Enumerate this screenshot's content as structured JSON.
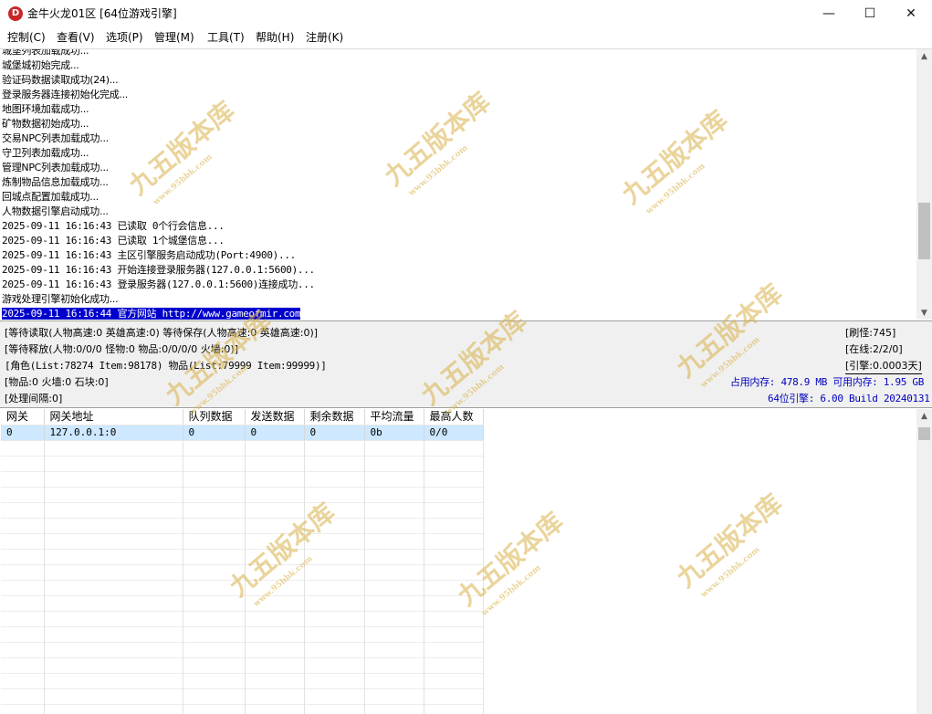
{
  "window": {
    "app_icon_letter": "D",
    "title": "金牛火龙01区 [64位游戏引擎]",
    "minimize_glyph": "—",
    "maximize_glyph": "☐",
    "close_glyph": "✕"
  },
  "menu": [
    "控制(C)",
    "查看(V)",
    "选项(P)",
    "管理(M)",
    "工具(T)",
    "帮助(H)",
    "注册(K)"
  ],
  "log": [
    "城堡列表加载成功...",
    "城堡城初始完成...",
    "验证码数据读取成功(24)...",
    "登录服务器连接初始化完成...",
    "地图环境加载成功...",
    "矿物数据初始成功...",
    "交易NPC列表加载成功...",
    "守卫列表加载成功...",
    "管理NPC列表加载成功...",
    "炼制物品信息加载成功...",
    "回城点配置加载成功...",
    "人物数据引擎启动成功...",
    "2025-09-11 16:16:43 已读取 0个行会信息...",
    "2025-09-11 16:16:43 已读取 1个城堡信息...",
    "2025-09-11 16:16:43 主区引擎服务启动成功(Port:4900)...",
    "2025-09-11 16:16:43 开始连接登录服务器(127.0.0.1:5600)...",
    "2025-09-11 16:16:43 登录服务器(127.0.0.1:5600)连接成功...",
    "游戏处理引擎初始化成功...",
    "2025-09-11 16:16:44 官方网站 http://www.gameofmir.com"
  ],
  "status": {
    "wait_read": "[等待读取(人物高速:0 英雄高速:0) 等待保存(人物高速:0 英雄高速:0)]",
    "wait_release": "[等待释放(人物:0/0/0 怪物:0 物品:0/0/0/0 火墙:0)]",
    "role_list": "[角色(List:78274 Item:98178) 物品(List:79999 Item:99999)]",
    "items": "[物品:0 火墙:0 石块:0]",
    "interval": "[处理间隔:0]",
    "refresh_monster": "[刷怪:745]",
    "online": "[在线:2/2/0]",
    "engine": "[引擎:0.0003天]",
    "memory": "占用内存: 478.9 MB 可用内存: 1.95 GB",
    "build": "64位引擎: 6.00 Build 20240131"
  },
  "gateway_table": {
    "columns": [
      "网关",
      "网关地址",
      "队列数据",
      "发送数据",
      "剩余数据",
      "平均流量",
      "最高人数"
    ],
    "rows": [
      [
        "0",
        "127.0.0.1:0",
        "0",
        "0",
        "0",
        "0b",
        "0/0"
      ]
    ]
  },
  "watermark": {
    "title": "九五版本库",
    "url": "www.95bbk.com",
    "color": "#d9b24a"
  },
  "colors": {
    "selection": "#0000cc",
    "status_bg": "#f0f0f0",
    "info_blue": "#0000c0",
    "row_select": "#cde8ff"
  }
}
